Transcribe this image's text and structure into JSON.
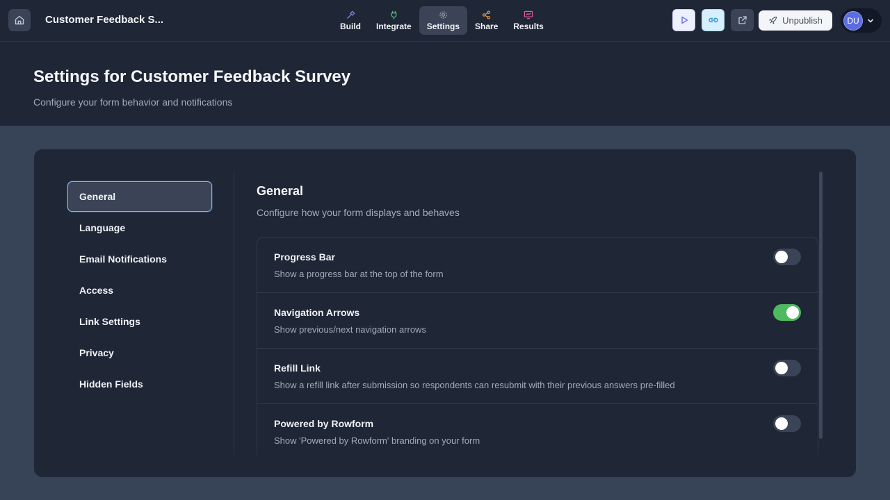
{
  "topbar": {
    "form_title": "Customer Feedback S...",
    "tabs": [
      {
        "label": "Build",
        "icon": "hammer-icon",
        "color": "#7c84f0"
      },
      {
        "label": "Integrate",
        "icon": "plug-icon",
        "color": "#4dc07a"
      },
      {
        "label": "Settings",
        "icon": "gear-icon",
        "color": "#9aa3b2",
        "active": true
      },
      {
        "label": "Share",
        "icon": "share-icon",
        "color": "#e8974a"
      },
      {
        "label": "Results",
        "icon": "chart-monitor-icon",
        "color": "#e25b9e"
      }
    ],
    "unpublish_label": "Unpublish",
    "avatar_initials": "DU"
  },
  "header": {
    "title": "Settings for Customer Feedback Survey",
    "subtitle": "Configure your form behavior and notifications"
  },
  "sidenav": {
    "items": [
      {
        "label": "General",
        "active": true
      },
      {
        "label": "Language"
      },
      {
        "label": "Email Notifications"
      },
      {
        "label": "Access"
      },
      {
        "label": "Link Settings"
      },
      {
        "label": "Privacy"
      },
      {
        "label": "Hidden Fields"
      }
    ]
  },
  "general": {
    "title": "General",
    "subtitle": "Configure how your form displays and behaves",
    "settings": [
      {
        "title": "Progress Bar",
        "desc": "Show a progress bar at the top of the form",
        "enabled": false
      },
      {
        "title": "Navigation Arrows",
        "desc": "Show previous/next navigation arrows",
        "enabled": true
      },
      {
        "title": "Refill Link",
        "desc": "Show a refill link after submission so respondents can resubmit with their previous answers pre-filled",
        "enabled": false
      },
      {
        "title": "Powered by Rowform",
        "desc": "Show 'Powered by Rowform' branding on your form",
        "enabled": false
      }
    ]
  },
  "colors": {
    "toggle_on": "#4dba5f",
    "active_outline": "#7fb6ef"
  }
}
